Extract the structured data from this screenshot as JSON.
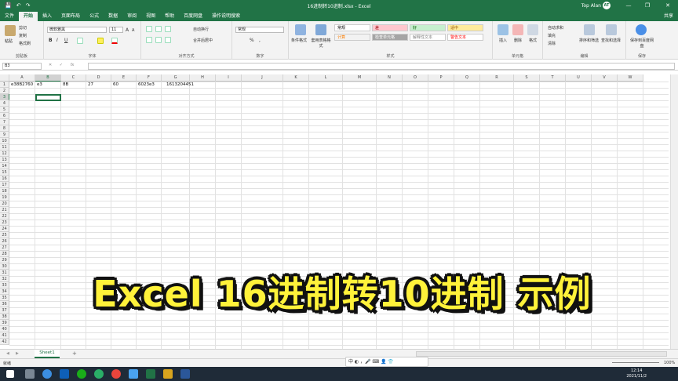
{
  "window": {
    "title": "16进制转10进制.xlsx - Excel",
    "user": "Top Alan",
    "avatar_initials": "AT",
    "minimize": "—",
    "restore": "❐",
    "close": "✕"
  },
  "quick_access": [
    "💾",
    "↶",
    "↷"
  ],
  "tabs": [
    "文件",
    "开始",
    "插入",
    "页面布局",
    "公式",
    "数据",
    "审阅",
    "视图",
    "帮助",
    "百度网盘",
    "操作说明搜索"
  ],
  "share_label": "共享",
  "ribbon": {
    "clipboard": {
      "label": "剪贴板",
      "paste": "粘贴",
      "cut": "剪切",
      "copy": "复制",
      "format_painter": "格式刷"
    },
    "font": {
      "label": "字体",
      "name": "微软雅黑",
      "size": "11",
      "bold": "B",
      "italic": "I",
      "underline": "U",
      "grow": "A",
      "shrink": "A"
    },
    "alignment": {
      "label": "对齐方式",
      "wrap": "自动换行",
      "merge": "合并后居中"
    },
    "number": {
      "label": "数字",
      "format": "常规",
      "percent": "%",
      "comma": ","
    },
    "styles": {
      "label": "样式",
      "conditional": "条件格式",
      "table": "套用表格格式",
      "cells": [
        {
          "text": "常规",
          "bg": "#ffffff",
          "fg": "#000000"
        },
        {
          "text": "差",
          "bg": "#ffc7ce",
          "fg": "#9c0006"
        },
        {
          "text": "好",
          "bg": "#c6efce",
          "fg": "#006100"
        },
        {
          "text": "适中",
          "bg": "#ffeb9c",
          "fg": "#9c5700"
        },
        {
          "text": "计算",
          "bg": "#f2f2f2",
          "fg": "#fa7d00"
        },
        {
          "text": "检查单元格",
          "bg": "#a5a5a5",
          "fg": "#ffffff"
        },
        {
          "text": "解释性文本",
          "bg": "#ffffff",
          "fg": "#7f7f7f"
        },
        {
          "text": "警告文本",
          "bg": "#ffffff",
          "fg": "#ff0000"
        }
      ]
    },
    "cells_group": {
      "label": "单元格",
      "insert": "插入",
      "delete": "删除",
      "format": "格式"
    },
    "editing": {
      "label": "编辑",
      "autosum": "自动求和",
      "fill": "填充",
      "clear": "清除",
      "sort": "排序和筛选",
      "find": "查找和选择"
    },
    "save": {
      "label": "保存",
      "save_to": "保存到百度网盘"
    }
  },
  "formula_bar": {
    "name_box": "B3",
    "fx": "fx",
    "cancel": "✕",
    "enter": "✓",
    "value": ""
  },
  "columns": [
    "A",
    "B",
    "C",
    "D",
    "E",
    "F",
    "G",
    "H",
    "I",
    "J",
    "K",
    "L",
    "M",
    "N",
    "O",
    "P",
    "Q",
    "R",
    "S",
    "T",
    "U",
    "V",
    "W"
  ],
  "rows": [
    "1",
    "2",
    "3",
    "4",
    "5",
    "6",
    "7",
    "8",
    "9",
    "10",
    "11",
    "12",
    "13",
    "14",
    "15",
    "16",
    "17",
    "18",
    "19",
    "20",
    "21",
    "22",
    "23",
    "24",
    "25",
    "26",
    "27",
    "28",
    "29",
    "30",
    "31",
    "32",
    "33",
    "34",
    "35",
    "36",
    "37",
    "38",
    "39",
    "40",
    "41",
    "42"
  ],
  "row1": {
    "A": "e38B2760",
    "B": "e3",
    "C": "8B",
    "D": "27",
    "E": "60",
    "F": "6023e3",
    "G": "1613204451"
  },
  "selected_cell": "B3",
  "sheet": {
    "name": "Sheet1",
    "add": "+"
  },
  "status": {
    "ready": "就绪",
    "zoom": "100%"
  },
  "overlay_text": "Excel 16进制转10进制 示例",
  "ime": {
    "text": "中 ◐ ，🎤 ⌨ 👤 👕"
  },
  "taskbar": {
    "time": "12:14",
    "date": "2021/11/2"
  },
  "colors": {
    "excel_green": "#217346",
    "overlay_yellow": "#fff23a"
  }
}
